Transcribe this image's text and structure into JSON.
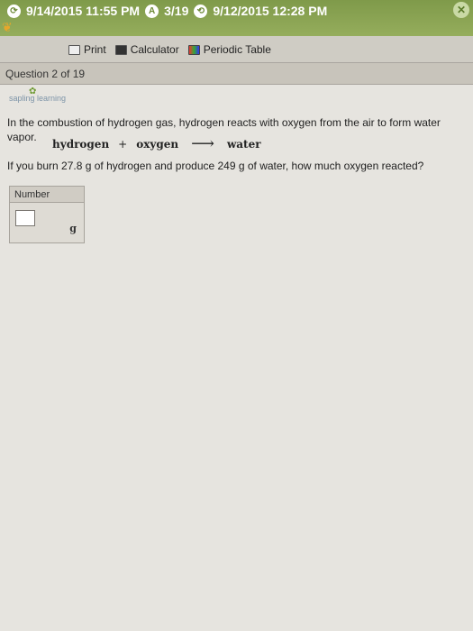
{
  "status_bar": {
    "item1": "9/14/2015 11:55 PM",
    "item2": "3/19",
    "item3": "9/12/2015 12:28 PM"
  },
  "toolbar": {
    "print": "Print",
    "calculator": "Calculator",
    "periodic_table": "Periodic Table"
  },
  "question": {
    "header": "Question 2 of 19",
    "brand": "sapling learning",
    "intro": "In the combustion of hydrogen gas, hydrogen reacts with oxygen from the air to form water vapor.",
    "equation": {
      "reactant1": "hydrogen",
      "plus": "+",
      "reactant2": "oxygen",
      "arrow": "⟶",
      "product": "water"
    },
    "problem": "If you burn 27.8 g of hydrogen and produce 249 g of water, how much oxygen reacted?",
    "answer": {
      "label": "Number",
      "value": "",
      "unit": "g"
    }
  },
  "colors": {
    "header_green": "#7f9a4a",
    "panel_bg": "#e6e4df"
  }
}
